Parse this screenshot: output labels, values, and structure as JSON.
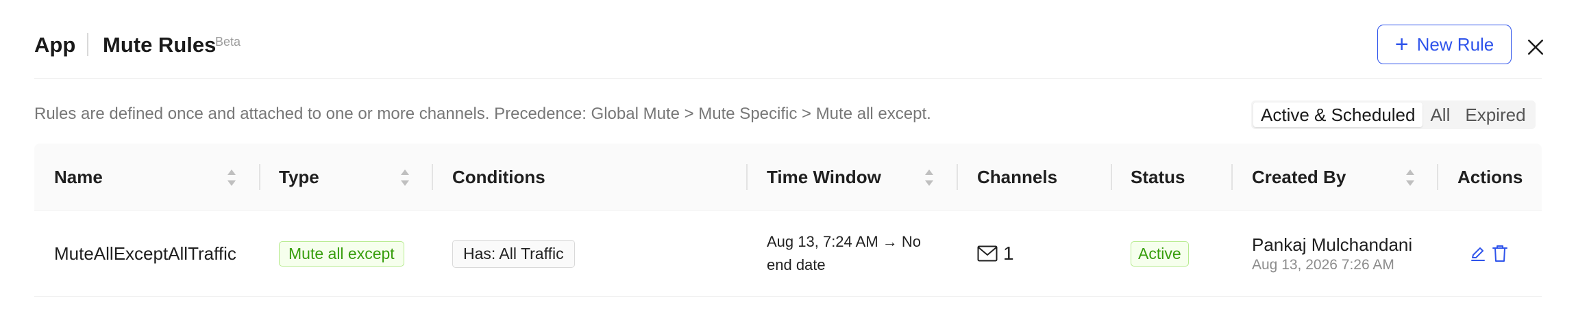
{
  "header": {
    "app_title": "App",
    "page_title": "Mute Rules",
    "badge": "Beta",
    "new_rule_label": "New Rule",
    "new_rule_icon": "plus-icon",
    "close_icon": "close-icon"
  },
  "description": "Rules are defined once and attached to one or more channels. Precedence: Global Mute > Mute Specific > Mute all except.",
  "filters": {
    "options": [
      "Active & Scheduled",
      "All",
      "Expired"
    ],
    "selected": "Active & Scheduled"
  },
  "table": {
    "columns": [
      "Name",
      "Type",
      "Conditions",
      "Time Window",
      "Channels",
      "Status",
      "Created By",
      "Actions"
    ],
    "rows": [
      {
        "name": "MuteAllExceptAllTraffic",
        "type": "Mute all except",
        "conditions": "Has: All Traffic",
        "time_window": "Aug 13, 7:24 AM → No end date",
        "channels_icon": "mail-icon",
        "channels_count": "1",
        "status": "Active",
        "created_by_name": "Pankaj Mulchandani",
        "created_by_date": "Aug 13, 2026 7:26 AM",
        "actions": [
          "edit-icon",
          "delete-icon"
        ]
      }
    ]
  },
  "colors": {
    "primary": "#2f54eb",
    "success_text": "#389e0d",
    "success_border": "#b7eb8f",
    "success_bg": "#f6ffed"
  }
}
